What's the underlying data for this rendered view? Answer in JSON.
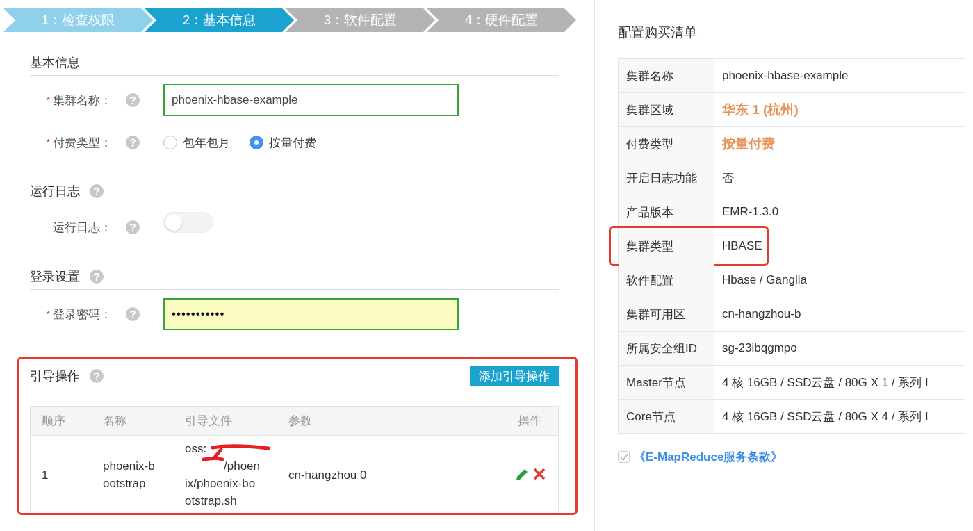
{
  "steps": [
    {
      "label": "1：检查权限",
      "selected": false,
      "completed": true
    },
    {
      "label": "2：基本信息",
      "selected": true,
      "completed": false
    },
    {
      "label": "3：软件配置",
      "selected": false,
      "completed": false
    },
    {
      "label": "4：硬件配置",
      "selected": false,
      "completed": false
    }
  ],
  "sections": [
    {
      "title": "基本信息",
      "fields": [
        {
          "mark": "*",
          "label": "集群名称：",
          "kind": "text",
          "value": "phoenix-hbase-example"
        },
        {
          "mark": "*",
          "label": "付费类型：",
          "kind": "radio",
          "options": [
            {
              "label": "包年包月",
              "selected": false
            },
            {
              "label": "按量付费",
              "selected": true
            }
          ]
        }
      ]
    },
    {
      "title": "运行日志",
      "help": true,
      "fields": [
        {
          "label": "运行日志：",
          "kind": "switch",
          "on": false
        }
      ]
    },
    {
      "title": "登录设置",
      "help": true,
      "fields": [
        {
          "mark": "*",
          "label": "登录密码：",
          "kind": "password",
          "value": "•••••••••••"
        }
      ]
    }
  ],
  "bootstrap": {
    "title": "引导操作",
    "highlighted": true,
    "add_button": "添加引导操作",
    "columns": [
      "顺序",
      "名称",
      "引导文件",
      "参数",
      "操作"
    ],
    "rows": [
      {
        "order": "1",
        "name": "phoenix-bootstrap",
        "file_lines": [
          "oss:",
          "/phoen",
          "ix/phoenix-bo",
          "otstrap.sh"
        ],
        "params": "cn-hangzhou 0"
      }
    ]
  },
  "summary": {
    "title": "配置购买清单",
    "rows": [
      {
        "label": "集群名称",
        "value": "phoenix-hbase-example",
        "emphasis": false,
        "highlighted": false
      },
      {
        "label": "集群区域",
        "value": "华东 1 (杭州)",
        "emphasis": true,
        "highlighted": false
      },
      {
        "label": "付费类型",
        "value": "按量付费",
        "emphasis": true,
        "highlighted": false
      },
      {
        "label": "开启日志功能",
        "value": "否",
        "emphasis": false,
        "highlighted": false
      },
      {
        "label": "产品版本",
        "value": "EMR-1.3.0",
        "emphasis": false,
        "highlighted": false
      },
      {
        "label": "集群类型",
        "value": "HBASE",
        "emphasis": false,
        "highlighted": true
      },
      {
        "label": "软件配置",
        "value": "Hbase / Ganglia",
        "emphasis": false,
        "highlighted": false
      },
      {
        "label": "集群可用区",
        "value": "cn-hangzhou-b",
        "emphasis": false,
        "highlighted": false
      },
      {
        "label": "所属安全组ID",
        "value": "sg-23ibqgmpo",
        "emphasis": false,
        "highlighted": false
      },
      {
        "label": "Master节点",
        "value": "4 核 16GB / SSD云盘 / 80G X 1 / 系列 I",
        "emphasis": false,
        "highlighted": false
      },
      {
        "label": "Core节点",
        "value": "4 核 16GB / SSD云盘 / 80G X 4 / 系列 I",
        "emphasis": false,
        "highlighted": false
      }
    ],
    "agreement": {
      "checked": true,
      "text": "《E-MapReduce服务条款》"
    }
  }
}
